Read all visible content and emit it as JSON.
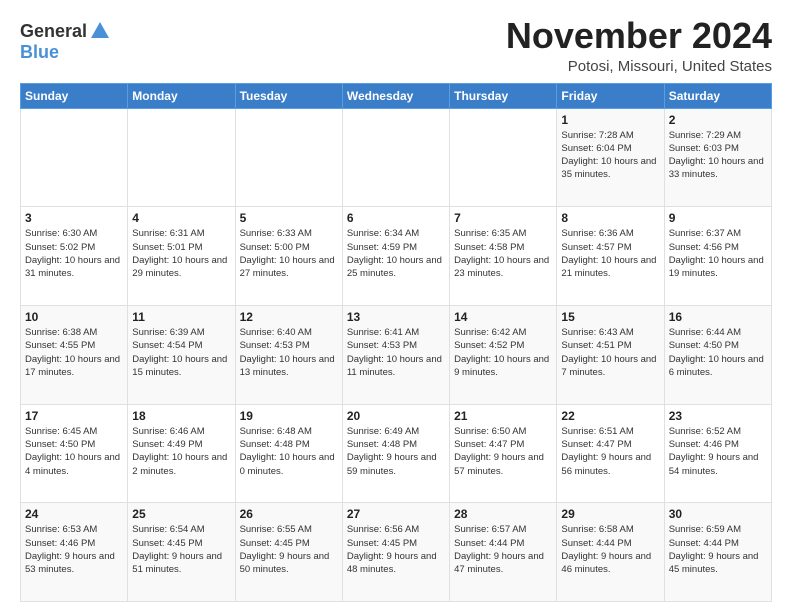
{
  "logo": {
    "general": "General",
    "blue": "Blue"
  },
  "title": "November 2024",
  "location": "Potosi, Missouri, United States",
  "days_of_week": [
    "Sunday",
    "Monday",
    "Tuesday",
    "Wednesday",
    "Thursday",
    "Friday",
    "Saturday"
  ],
  "weeks": [
    [
      {
        "day": "",
        "info": ""
      },
      {
        "day": "",
        "info": ""
      },
      {
        "day": "",
        "info": ""
      },
      {
        "day": "",
        "info": ""
      },
      {
        "day": "",
        "info": ""
      },
      {
        "day": "1",
        "info": "Sunrise: 7:28 AM\nSunset: 6:04 PM\nDaylight: 10 hours and 35 minutes."
      },
      {
        "day": "2",
        "info": "Sunrise: 7:29 AM\nSunset: 6:03 PM\nDaylight: 10 hours and 33 minutes."
      }
    ],
    [
      {
        "day": "3",
        "info": "Sunrise: 6:30 AM\nSunset: 5:02 PM\nDaylight: 10 hours and 31 minutes."
      },
      {
        "day": "4",
        "info": "Sunrise: 6:31 AM\nSunset: 5:01 PM\nDaylight: 10 hours and 29 minutes."
      },
      {
        "day": "5",
        "info": "Sunrise: 6:33 AM\nSunset: 5:00 PM\nDaylight: 10 hours and 27 minutes."
      },
      {
        "day": "6",
        "info": "Sunrise: 6:34 AM\nSunset: 4:59 PM\nDaylight: 10 hours and 25 minutes."
      },
      {
        "day": "7",
        "info": "Sunrise: 6:35 AM\nSunset: 4:58 PM\nDaylight: 10 hours and 23 minutes."
      },
      {
        "day": "8",
        "info": "Sunrise: 6:36 AM\nSunset: 4:57 PM\nDaylight: 10 hours and 21 minutes."
      },
      {
        "day": "9",
        "info": "Sunrise: 6:37 AM\nSunset: 4:56 PM\nDaylight: 10 hours and 19 minutes."
      }
    ],
    [
      {
        "day": "10",
        "info": "Sunrise: 6:38 AM\nSunset: 4:55 PM\nDaylight: 10 hours and 17 minutes."
      },
      {
        "day": "11",
        "info": "Sunrise: 6:39 AM\nSunset: 4:54 PM\nDaylight: 10 hours and 15 minutes."
      },
      {
        "day": "12",
        "info": "Sunrise: 6:40 AM\nSunset: 4:53 PM\nDaylight: 10 hours and 13 minutes."
      },
      {
        "day": "13",
        "info": "Sunrise: 6:41 AM\nSunset: 4:53 PM\nDaylight: 10 hours and 11 minutes."
      },
      {
        "day": "14",
        "info": "Sunrise: 6:42 AM\nSunset: 4:52 PM\nDaylight: 10 hours and 9 minutes."
      },
      {
        "day": "15",
        "info": "Sunrise: 6:43 AM\nSunset: 4:51 PM\nDaylight: 10 hours and 7 minutes."
      },
      {
        "day": "16",
        "info": "Sunrise: 6:44 AM\nSunset: 4:50 PM\nDaylight: 10 hours and 6 minutes."
      }
    ],
    [
      {
        "day": "17",
        "info": "Sunrise: 6:45 AM\nSunset: 4:50 PM\nDaylight: 10 hours and 4 minutes."
      },
      {
        "day": "18",
        "info": "Sunrise: 6:46 AM\nSunset: 4:49 PM\nDaylight: 10 hours and 2 minutes."
      },
      {
        "day": "19",
        "info": "Sunrise: 6:48 AM\nSunset: 4:48 PM\nDaylight: 10 hours and 0 minutes."
      },
      {
        "day": "20",
        "info": "Sunrise: 6:49 AM\nSunset: 4:48 PM\nDaylight: 9 hours and 59 minutes."
      },
      {
        "day": "21",
        "info": "Sunrise: 6:50 AM\nSunset: 4:47 PM\nDaylight: 9 hours and 57 minutes."
      },
      {
        "day": "22",
        "info": "Sunrise: 6:51 AM\nSunset: 4:47 PM\nDaylight: 9 hours and 56 minutes."
      },
      {
        "day": "23",
        "info": "Sunrise: 6:52 AM\nSunset: 4:46 PM\nDaylight: 9 hours and 54 minutes."
      }
    ],
    [
      {
        "day": "24",
        "info": "Sunrise: 6:53 AM\nSunset: 4:46 PM\nDaylight: 9 hours and 53 minutes."
      },
      {
        "day": "25",
        "info": "Sunrise: 6:54 AM\nSunset: 4:45 PM\nDaylight: 9 hours and 51 minutes."
      },
      {
        "day": "26",
        "info": "Sunrise: 6:55 AM\nSunset: 4:45 PM\nDaylight: 9 hours and 50 minutes."
      },
      {
        "day": "27",
        "info": "Sunrise: 6:56 AM\nSunset: 4:45 PM\nDaylight: 9 hours and 48 minutes."
      },
      {
        "day": "28",
        "info": "Sunrise: 6:57 AM\nSunset: 4:44 PM\nDaylight: 9 hours and 47 minutes."
      },
      {
        "day": "29",
        "info": "Sunrise: 6:58 AM\nSunset: 4:44 PM\nDaylight: 9 hours and 46 minutes."
      },
      {
        "day": "30",
        "info": "Sunrise: 6:59 AM\nSunset: 4:44 PM\nDaylight: 9 hours and 45 minutes."
      }
    ]
  ]
}
